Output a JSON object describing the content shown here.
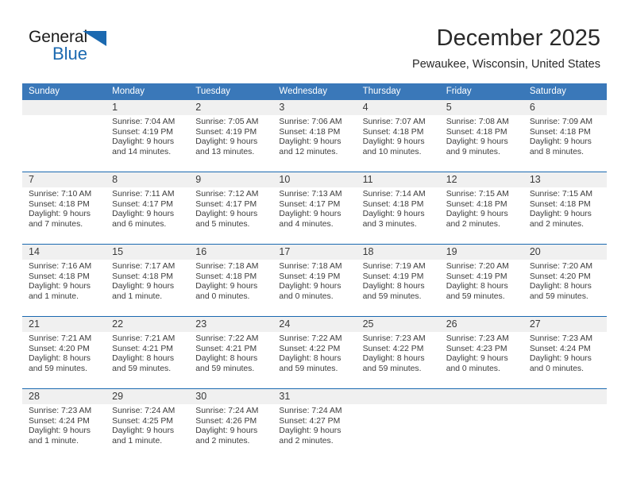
{
  "brand": {
    "word_general": "General",
    "word_blue": "Blue",
    "accent_color": "#1b69b0"
  },
  "header": {
    "title": "December 2025",
    "location": "Pewaukee, Wisconsin, United States"
  },
  "colors": {
    "header_blue": "#3a78b9",
    "separator_blue": "#1b69b0",
    "daynum_band": "#f0f0f0",
    "text": "#3c3c3c"
  },
  "weekday_headers": [
    "Sunday",
    "Monday",
    "Tuesday",
    "Wednesday",
    "Thursday",
    "Friday",
    "Saturday"
  ],
  "weeks": [
    {
      "days": [
        {
          "date": "",
          "sunrise": "",
          "sunset": "",
          "daylight_line1": "",
          "daylight_line2": ""
        },
        {
          "date": "1",
          "sunrise": "Sunrise: 7:04 AM",
          "sunset": "Sunset: 4:19 PM",
          "daylight_line1": "Daylight: 9 hours",
          "daylight_line2": "and 14 minutes."
        },
        {
          "date": "2",
          "sunrise": "Sunrise: 7:05 AM",
          "sunset": "Sunset: 4:19 PM",
          "daylight_line1": "Daylight: 9 hours",
          "daylight_line2": "and 13 minutes."
        },
        {
          "date": "3",
          "sunrise": "Sunrise: 7:06 AM",
          "sunset": "Sunset: 4:18 PM",
          "daylight_line1": "Daylight: 9 hours",
          "daylight_line2": "and 12 minutes."
        },
        {
          "date": "4",
          "sunrise": "Sunrise: 7:07 AM",
          "sunset": "Sunset: 4:18 PM",
          "daylight_line1": "Daylight: 9 hours",
          "daylight_line2": "and 10 minutes."
        },
        {
          "date": "5",
          "sunrise": "Sunrise: 7:08 AM",
          "sunset": "Sunset: 4:18 PM",
          "daylight_line1": "Daylight: 9 hours",
          "daylight_line2": "and 9 minutes."
        },
        {
          "date": "6",
          "sunrise": "Sunrise: 7:09 AM",
          "sunset": "Sunset: 4:18 PM",
          "daylight_line1": "Daylight: 9 hours",
          "daylight_line2": "and 8 minutes."
        }
      ]
    },
    {
      "days": [
        {
          "date": "7",
          "sunrise": "Sunrise: 7:10 AM",
          "sunset": "Sunset: 4:18 PM",
          "daylight_line1": "Daylight: 9 hours",
          "daylight_line2": "and 7 minutes."
        },
        {
          "date": "8",
          "sunrise": "Sunrise: 7:11 AM",
          "sunset": "Sunset: 4:17 PM",
          "daylight_line1": "Daylight: 9 hours",
          "daylight_line2": "and 6 minutes."
        },
        {
          "date": "9",
          "sunrise": "Sunrise: 7:12 AM",
          "sunset": "Sunset: 4:17 PM",
          "daylight_line1": "Daylight: 9 hours",
          "daylight_line2": "and 5 minutes."
        },
        {
          "date": "10",
          "sunrise": "Sunrise: 7:13 AM",
          "sunset": "Sunset: 4:17 PM",
          "daylight_line1": "Daylight: 9 hours",
          "daylight_line2": "and 4 minutes."
        },
        {
          "date": "11",
          "sunrise": "Sunrise: 7:14 AM",
          "sunset": "Sunset: 4:18 PM",
          "daylight_line1": "Daylight: 9 hours",
          "daylight_line2": "and 3 minutes."
        },
        {
          "date": "12",
          "sunrise": "Sunrise: 7:15 AM",
          "sunset": "Sunset: 4:18 PM",
          "daylight_line1": "Daylight: 9 hours",
          "daylight_line2": "and 2 minutes."
        },
        {
          "date": "13",
          "sunrise": "Sunrise: 7:15 AM",
          "sunset": "Sunset: 4:18 PM",
          "daylight_line1": "Daylight: 9 hours",
          "daylight_line2": "and 2 minutes."
        }
      ]
    },
    {
      "days": [
        {
          "date": "14",
          "sunrise": "Sunrise: 7:16 AM",
          "sunset": "Sunset: 4:18 PM",
          "daylight_line1": "Daylight: 9 hours",
          "daylight_line2": "and 1 minute."
        },
        {
          "date": "15",
          "sunrise": "Sunrise: 7:17 AM",
          "sunset": "Sunset: 4:18 PM",
          "daylight_line1": "Daylight: 9 hours",
          "daylight_line2": "and 1 minute."
        },
        {
          "date": "16",
          "sunrise": "Sunrise: 7:18 AM",
          "sunset": "Sunset: 4:18 PM",
          "daylight_line1": "Daylight: 9 hours",
          "daylight_line2": "and 0 minutes."
        },
        {
          "date": "17",
          "sunrise": "Sunrise: 7:18 AM",
          "sunset": "Sunset: 4:19 PM",
          "daylight_line1": "Daylight: 9 hours",
          "daylight_line2": "and 0 minutes."
        },
        {
          "date": "18",
          "sunrise": "Sunrise: 7:19 AM",
          "sunset": "Sunset: 4:19 PM",
          "daylight_line1": "Daylight: 8 hours",
          "daylight_line2": "and 59 minutes."
        },
        {
          "date": "19",
          "sunrise": "Sunrise: 7:20 AM",
          "sunset": "Sunset: 4:19 PM",
          "daylight_line1": "Daylight: 8 hours",
          "daylight_line2": "and 59 minutes."
        },
        {
          "date": "20",
          "sunrise": "Sunrise: 7:20 AM",
          "sunset": "Sunset: 4:20 PM",
          "daylight_line1": "Daylight: 8 hours",
          "daylight_line2": "and 59 minutes."
        }
      ]
    },
    {
      "days": [
        {
          "date": "21",
          "sunrise": "Sunrise: 7:21 AM",
          "sunset": "Sunset: 4:20 PM",
          "daylight_line1": "Daylight: 8 hours",
          "daylight_line2": "and 59 minutes."
        },
        {
          "date": "22",
          "sunrise": "Sunrise: 7:21 AM",
          "sunset": "Sunset: 4:21 PM",
          "daylight_line1": "Daylight: 8 hours",
          "daylight_line2": "and 59 minutes."
        },
        {
          "date": "23",
          "sunrise": "Sunrise: 7:22 AM",
          "sunset": "Sunset: 4:21 PM",
          "daylight_line1": "Daylight: 8 hours",
          "daylight_line2": "and 59 minutes."
        },
        {
          "date": "24",
          "sunrise": "Sunrise: 7:22 AM",
          "sunset": "Sunset: 4:22 PM",
          "daylight_line1": "Daylight: 8 hours",
          "daylight_line2": "and 59 minutes."
        },
        {
          "date": "25",
          "sunrise": "Sunrise: 7:23 AM",
          "sunset": "Sunset: 4:22 PM",
          "daylight_line1": "Daylight: 8 hours",
          "daylight_line2": "and 59 minutes."
        },
        {
          "date": "26",
          "sunrise": "Sunrise: 7:23 AM",
          "sunset": "Sunset: 4:23 PM",
          "daylight_line1": "Daylight: 9 hours",
          "daylight_line2": "and 0 minutes."
        },
        {
          "date": "27",
          "sunrise": "Sunrise: 7:23 AM",
          "sunset": "Sunset: 4:24 PM",
          "daylight_line1": "Daylight: 9 hours",
          "daylight_line2": "and 0 minutes."
        }
      ]
    },
    {
      "days": [
        {
          "date": "28",
          "sunrise": "Sunrise: 7:23 AM",
          "sunset": "Sunset: 4:24 PM",
          "daylight_line1": "Daylight: 9 hours",
          "daylight_line2": "and 1 minute."
        },
        {
          "date": "29",
          "sunrise": "Sunrise: 7:24 AM",
          "sunset": "Sunset: 4:25 PM",
          "daylight_line1": "Daylight: 9 hours",
          "daylight_line2": "and 1 minute."
        },
        {
          "date": "30",
          "sunrise": "Sunrise: 7:24 AM",
          "sunset": "Sunset: 4:26 PM",
          "daylight_line1": "Daylight: 9 hours",
          "daylight_line2": "and 2 minutes."
        },
        {
          "date": "31",
          "sunrise": "Sunrise: 7:24 AM",
          "sunset": "Sunset: 4:27 PM",
          "daylight_line1": "Daylight: 9 hours",
          "daylight_line2": "and 2 minutes."
        },
        {
          "date": "",
          "sunrise": "",
          "sunset": "",
          "daylight_line1": "",
          "daylight_line2": ""
        },
        {
          "date": "",
          "sunrise": "",
          "sunset": "",
          "daylight_line1": "",
          "daylight_line2": ""
        },
        {
          "date": "",
          "sunrise": "",
          "sunset": "",
          "daylight_line1": "",
          "daylight_line2": ""
        }
      ]
    }
  ]
}
